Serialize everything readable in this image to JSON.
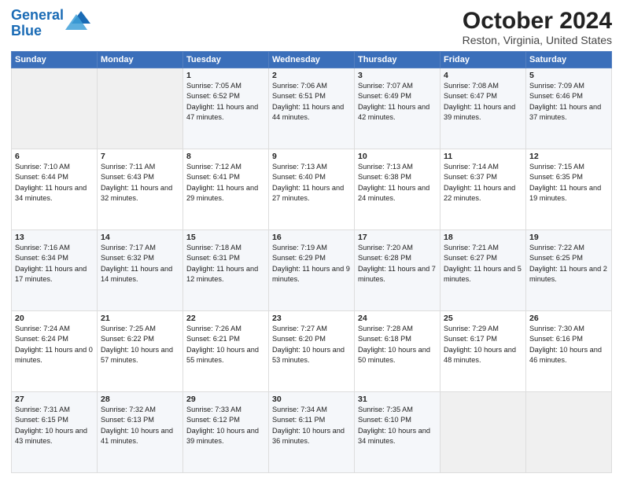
{
  "header": {
    "logo_line1": "General",
    "logo_line2": "Blue",
    "title": "October 2024",
    "subtitle": "Reston, Virginia, United States"
  },
  "days_of_week": [
    "Sunday",
    "Monday",
    "Tuesday",
    "Wednesday",
    "Thursday",
    "Friday",
    "Saturday"
  ],
  "weeks": [
    [
      {
        "day": "",
        "sunrise": "",
        "sunset": "",
        "daylight": ""
      },
      {
        "day": "",
        "sunrise": "",
        "sunset": "",
        "daylight": ""
      },
      {
        "day": "1",
        "sunrise": "Sunrise: 7:05 AM",
        "sunset": "Sunset: 6:52 PM",
        "daylight": "Daylight: 11 hours and 47 minutes."
      },
      {
        "day": "2",
        "sunrise": "Sunrise: 7:06 AM",
        "sunset": "Sunset: 6:51 PM",
        "daylight": "Daylight: 11 hours and 44 minutes."
      },
      {
        "day": "3",
        "sunrise": "Sunrise: 7:07 AM",
        "sunset": "Sunset: 6:49 PM",
        "daylight": "Daylight: 11 hours and 42 minutes."
      },
      {
        "day": "4",
        "sunrise": "Sunrise: 7:08 AM",
        "sunset": "Sunset: 6:47 PM",
        "daylight": "Daylight: 11 hours and 39 minutes."
      },
      {
        "day": "5",
        "sunrise": "Sunrise: 7:09 AM",
        "sunset": "Sunset: 6:46 PM",
        "daylight": "Daylight: 11 hours and 37 minutes."
      }
    ],
    [
      {
        "day": "6",
        "sunrise": "Sunrise: 7:10 AM",
        "sunset": "Sunset: 6:44 PM",
        "daylight": "Daylight: 11 hours and 34 minutes."
      },
      {
        "day": "7",
        "sunrise": "Sunrise: 7:11 AM",
        "sunset": "Sunset: 6:43 PM",
        "daylight": "Daylight: 11 hours and 32 minutes."
      },
      {
        "day": "8",
        "sunrise": "Sunrise: 7:12 AM",
        "sunset": "Sunset: 6:41 PM",
        "daylight": "Daylight: 11 hours and 29 minutes."
      },
      {
        "day": "9",
        "sunrise": "Sunrise: 7:13 AM",
        "sunset": "Sunset: 6:40 PM",
        "daylight": "Daylight: 11 hours and 27 minutes."
      },
      {
        "day": "10",
        "sunrise": "Sunrise: 7:13 AM",
        "sunset": "Sunset: 6:38 PM",
        "daylight": "Daylight: 11 hours and 24 minutes."
      },
      {
        "day": "11",
        "sunrise": "Sunrise: 7:14 AM",
        "sunset": "Sunset: 6:37 PM",
        "daylight": "Daylight: 11 hours and 22 minutes."
      },
      {
        "day": "12",
        "sunrise": "Sunrise: 7:15 AM",
        "sunset": "Sunset: 6:35 PM",
        "daylight": "Daylight: 11 hours and 19 minutes."
      }
    ],
    [
      {
        "day": "13",
        "sunrise": "Sunrise: 7:16 AM",
        "sunset": "Sunset: 6:34 PM",
        "daylight": "Daylight: 11 hours and 17 minutes."
      },
      {
        "day": "14",
        "sunrise": "Sunrise: 7:17 AM",
        "sunset": "Sunset: 6:32 PM",
        "daylight": "Daylight: 11 hours and 14 minutes."
      },
      {
        "day": "15",
        "sunrise": "Sunrise: 7:18 AM",
        "sunset": "Sunset: 6:31 PM",
        "daylight": "Daylight: 11 hours and 12 minutes."
      },
      {
        "day": "16",
        "sunrise": "Sunrise: 7:19 AM",
        "sunset": "Sunset: 6:29 PM",
        "daylight": "Daylight: 11 hours and 9 minutes."
      },
      {
        "day": "17",
        "sunrise": "Sunrise: 7:20 AM",
        "sunset": "Sunset: 6:28 PM",
        "daylight": "Daylight: 11 hours and 7 minutes."
      },
      {
        "day": "18",
        "sunrise": "Sunrise: 7:21 AM",
        "sunset": "Sunset: 6:27 PM",
        "daylight": "Daylight: 11 hours and 5 minutes."
      },
      {
        "day": "19",
        "sunrise": "Sunrise: 7:22 AM",
        "sunset": "Sunset: 6:25 PM",
        "daylight": "Daylight: 11 hours and 2 minutes."
      }
    ],
    [
      {
        "day": "20",
        "sunrise": "Sunrise: 7:24 AM",
        "sunset": "Sunset: 6:24 PM",
        "daylight": "Daylight: 11 hours and 0 minutes."
      },
      {
        "day": "21",
        "sunrise": "Sunrise: 7:25 AM",
        "sunset": "Sunset: 6:22 PM",
        "daylight": "Daylight: 10 hours and 57 minutes."
      },
      {
        "day": "22",
        "sunrise": "Sunrise: 7:26 AM",
        "sunset": "Sunset: 6:21 PM",
        "daylight": "Daylight: 10 hours and 55 minutes."
      },
      {
        "day": "23",
        "sunrise": "Sunrise: 7:27 AM",
        "sunset": "Sunset: 6:20 PM",
        "daylight": "Daylight: 10 hours and 53 minutes."
      },
      {
        "day": "24",
        "sunrise": "Sunrise: 7:28 AM",
        "sunset": "Sunset: 6:18 PM",
        "daylight": "Daylight: 10 hours and 50 minutes."
      },
      {
        "day": "25",
        "sunrise": "Sunrise: 7:29 AM",
        "sunset": "Sunset: 6:17 PM",
        "daylight": "Daylight: 10 hours and 48 minutes."
      },
      {
        "day": "26",
        "sunrise": "Sunrise: 7:30 AM",
        "sunset": "Sunset: 6:16 PM",
        "daylight": "Daylight: 10 hours and 46 minutes."
      }
    ],
    [
      {
        "day": "27",
        "sunrise": "Sunrise: 7:31 AM",
        "sunset": "Sunset: 6:15 PM",
        "daylight": "Daylight: 10 hours and 43 minutes."
      },
      {
        "day": "28",
        "sunrise": "Sunrise: 7:32 AM",
        "sunset": "Sunset: 6:13 PM",
        "daylight": "Daylight: 10 hours and 41 minutes."
      },
      {
        "day": "29",
        "sunrise": "Sunrise: 7:33 AM",
        "sunset": "Sunset: 6:12 PM",
        "daylight": "Daylight: 10 hours and 39 minutes."
      },
      {
        "day": "30",
        "sunrise": "Sunrise: 7:34 AM",
        "sunset": "Sunset: 6:11 PM",
        "daylight": "Daylight: 10 hours and 36 minutes."
      },
      {
        "day": "31",
        "sunrise": "Sunrise: 7:35 AM",
        "sunset": "Sunset: 6:10 PM",
        "daylight": "Daylight: 10 hours and 34 minutes."
      },
      {
        "day": "",
        "sunrise": "",
        "sunset": "",
        "daylight": ""
      },
      {
        "day": "",
        "sunrise": "",
        "sunset": "",
        "daylight": ""
      }
    ]
  ]
}
